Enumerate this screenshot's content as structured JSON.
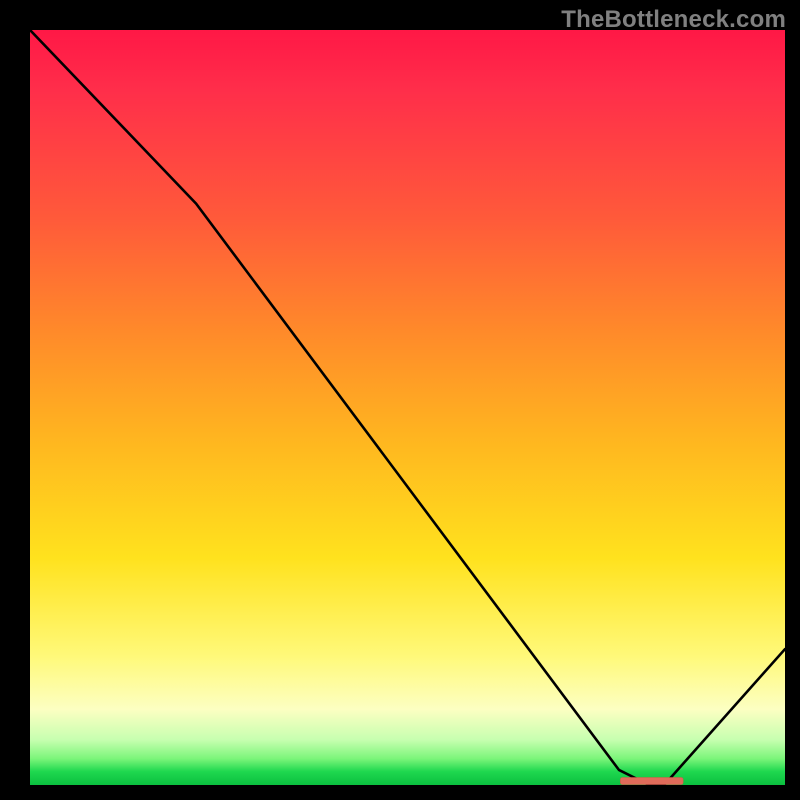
{
  "watermark": "TheBottleneck.com",
  "chart_data": {
    "type": "line",
    "title": "",
    "xlabel": "",
    "ylabel": "",
    "xlim": [
      0,
      100
    ],
    "ylim": [
      0,
      100
    ],
    "grid": false,
    "legend": false,
    "series": [
      {
        "name": "bottleneck-curve",
        "x": [
          0,
          22,
          78,
          82,
          84,
          100
        ],
        "y": [
          100,
          77,
          2,
          0,
          0,
          18
        ]
      }
    ],
    "highlight_band": {
      "name": "optimal-range",
      "x_start": 78.2,
      "x_end": 86.5,
      "y": 0.2,
      "color": "#e06b5a"
    },
    "background_gradient": {
      "stops": [
        {
          "pos": 0,
          "color": "#ff1846"
        },
        {
          "pos": 0.25,
          "color": "#ff5a3a"
        },
        {
          "pos": 0.55,
          "color": "#ffb81f"
        },
        {
          "pos": 0.83,
          "color": "#fff97a"
        },
        {
          "pos": 0.96,
          "color": "#7cf57a"
        },
        {
          "pos": 1.0,
          "color": "#0bbf3f"
        }
      ],
      "direction": "top-to-bottom"
    }
  }
}
